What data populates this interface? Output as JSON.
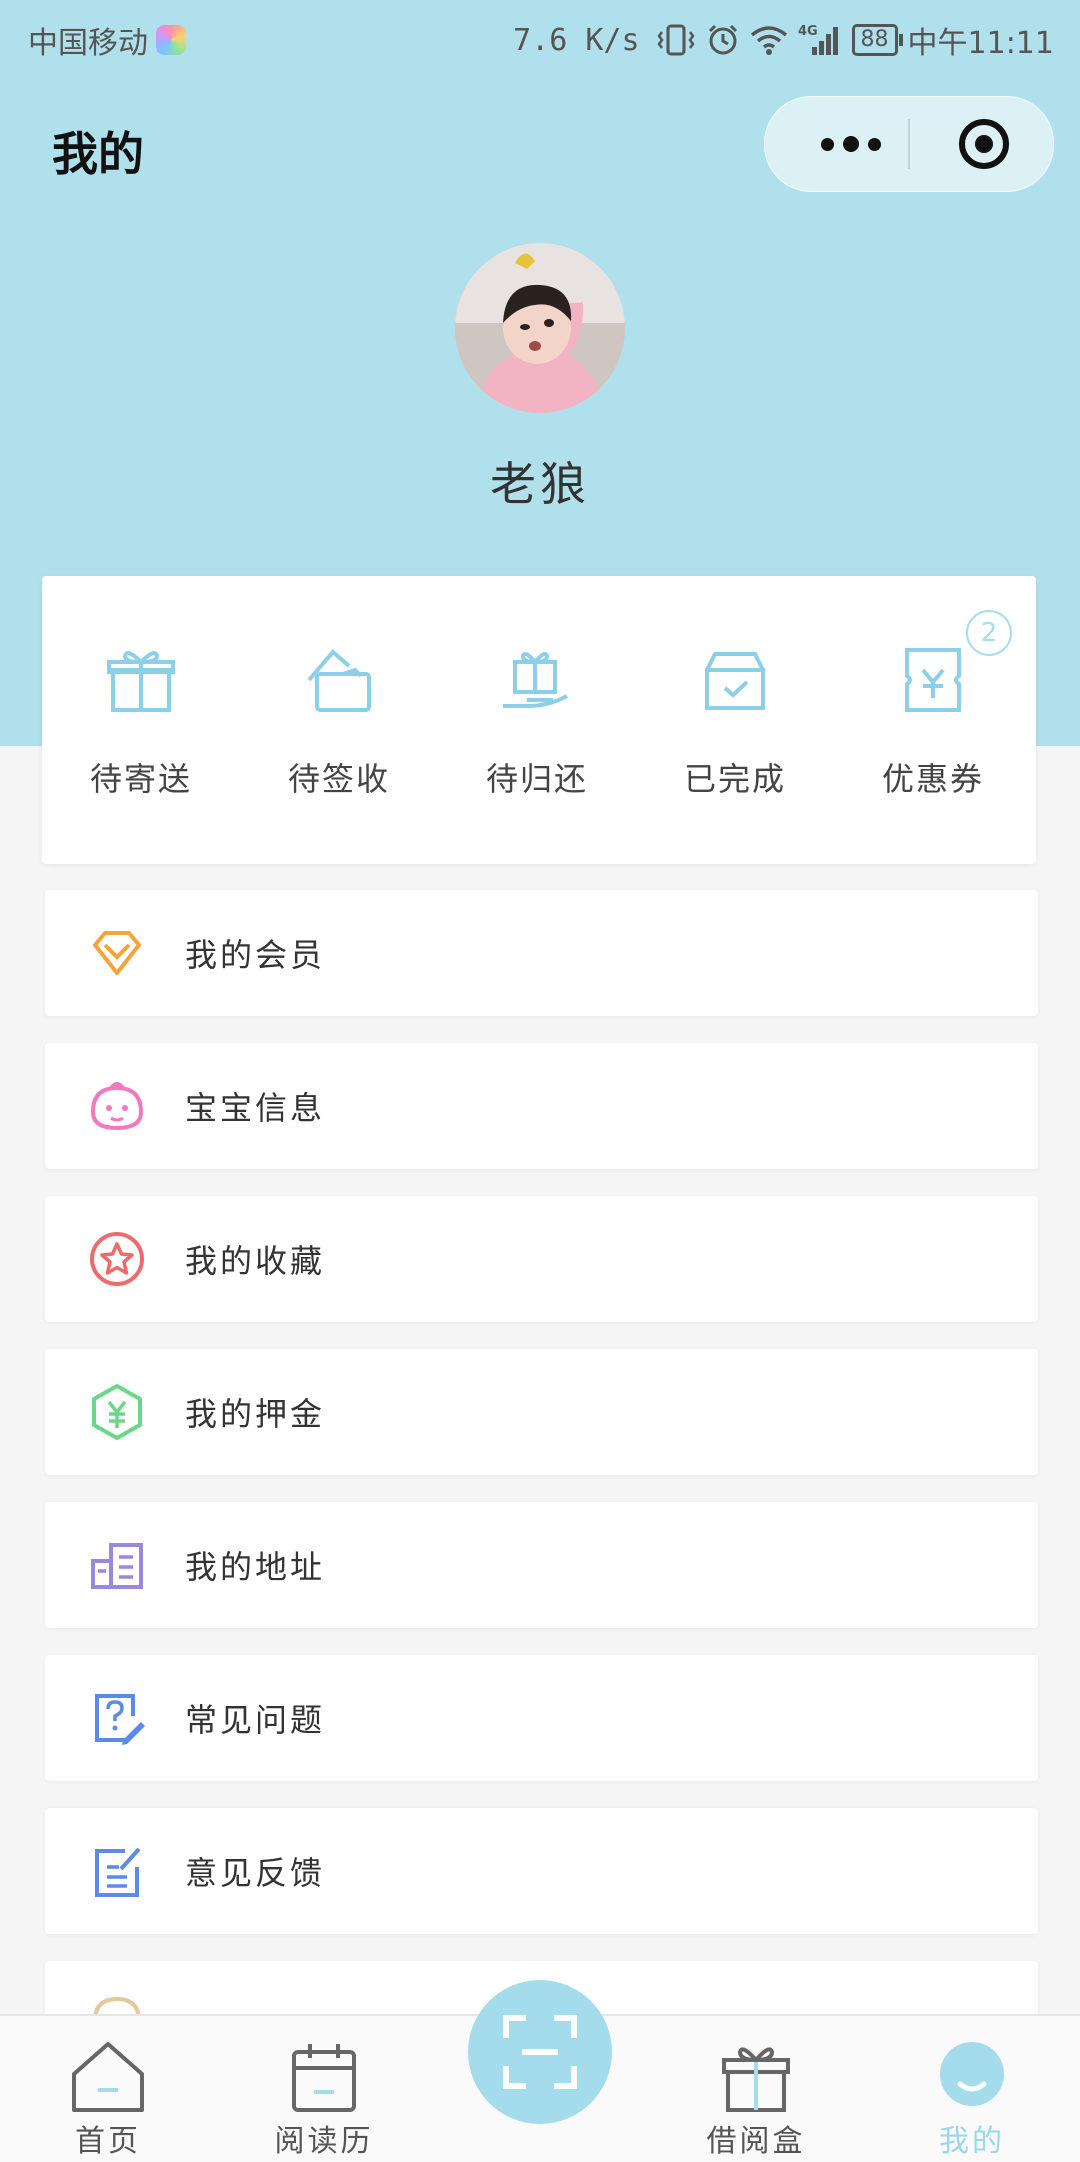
{
  "status_bar": {
    "carrier": "中国移动",
    "speed": "7.6 K/s",
    "network": "4G",
    "battery": "88",
    "time": "中午11:11"
  },
  "header": {
    "title": "我的"
  },
  "profile": {
    "username": "老狼"
  },
  "orders": {
    "items": [
      {
        "label": "待寄送",
        "icon": "gift-icon"
      },
      {
        "label": "待签收",
        "icon": "package-sign-icon"
      },
      {
        "label": "待归还",
        "icon": "return-gift-icon"
      },
      {
        "label": "已完成",
        "icon": "completed-box-icon"
      },
      {
        "label": "优惠券",
        "icon": "coupon-icon"
      }
    ],
    "coupon_badge": "2"
  },
  "menu": {
    "items": [
      {
        "label": "我的会员",
        "icon": "diamond-icon",
        "color": "#f5a43a"
      },
      {
        "label": "宝宝信息",
        "icon": "baby-face-icon",
        "color": "#f07ac0"
      },
      {
        "label": "我的收藏",
        "icon": "star-icon",
        "color": "#ee6b6b"
      },
      {
        "label": "我的押金",
        "icon": "yuan-hexagon-icon",
        "color": "#6cd68a"
      },
      {
        "label": "我的地址",
        "icon": "building-icon",
        "color": "#9a87de"
      },
      {
        "label": "常见问题",
        "icon": "question-edit-icon",
        "color": "#5a8be6"
      },
      {
        "label": "意见反馈",
        "icon": "feedback-edit-icon",
        "color": "#5a8be6"
      }
    ]
  },
  "tab_bar": {
    "items": [
      {
        "label": "首页",
        "icon": "home-icon"
      },
      {
        "label": "阅读历",
        "icon": "calendar-icon"
      },
      {
        "label": "借阅盒",
        "icon": "gift-box-icon"
      },
      {
        "label": "我的",
        "icon": "profile-icon"
      }
    ],
    "scan_icon": "scan-icon"
  },
  "colors": {
    "header_bg": "#b0e0ec",
    "accent": "#9bd7ea",
    "page_bg": "#f5f5f5"
  }
}
